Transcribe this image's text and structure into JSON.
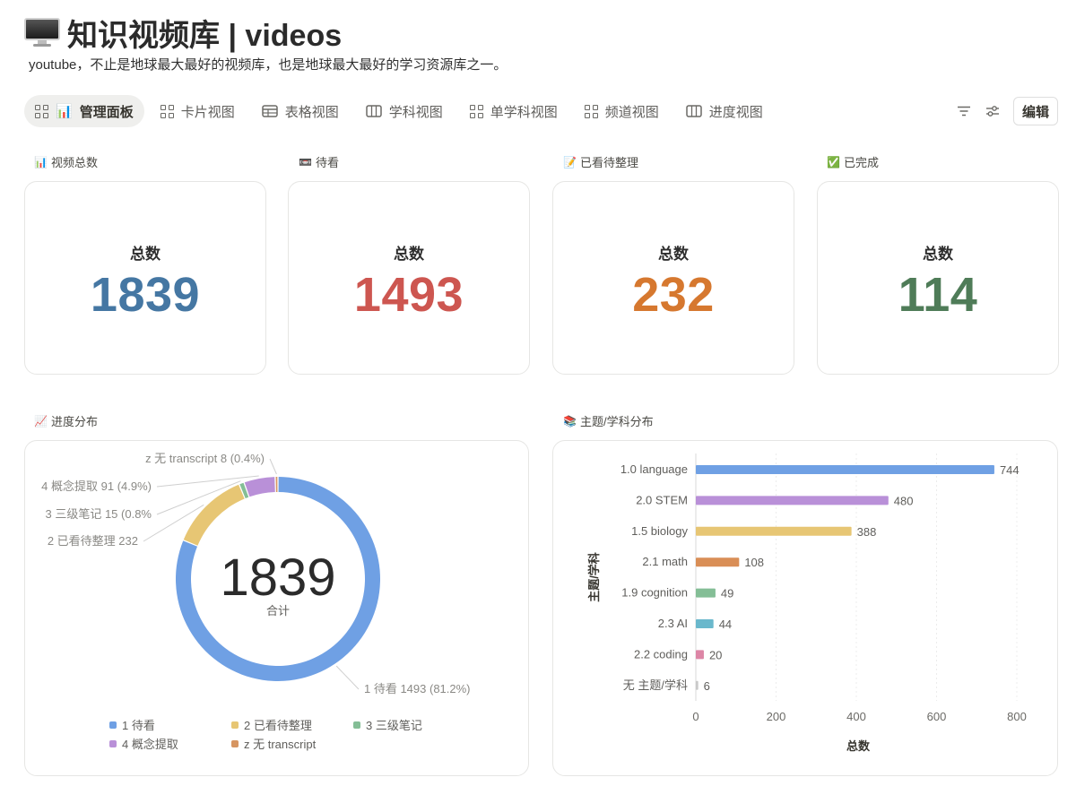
{
  "header": {
    "title": "知识视频库 | videos",
    "subtitle": "youtube，不止是地球最大最好的视频库，也是地球最大最好的学习资源库之一。"
  },
  "tabs": [
    {
      "label": "管理面板",
      "icon": "grid-icon",
      "emoji": "📊",
      "active": true
    },
    {
      "label": "卡片视图",
      "icon": "grid-icon"
    },
    {
      "label": "表格视图",
      "icon": "table-icon"
    },
    {
      "label": "学科视图",
      "icon": "columns-icon"
    },
    {
      "label": "单学科视图",
      "icon": "grid-icon"
    },
    {
      "label": "频道视图",
      "icon": "grid-icon"
    },
    {
      "label": "进度视图",
      "icon": "columns-icon"
    }
  ],
  "toolbar": {
    "edit_label": "编辑"
  },
  "stats": [
    {
      "section": "视频总数",
      "emoji": "📊",
      "label": "总数",
      "value": "1839",
      "color": "#4577a3"
    },
    {
      "section": "待看",
      "emoji": "📼",
      "label": "总数",
      "value": "1493",
      "color": "#cd5650"
    },
    {
      "section": "已看待整理",
      "emoji": "📝",
      "label": "总数",
      "value": "232",
      "color": "#d6782f"
    },
    {
      "section": "已完成",
      "emoji": "✅",
      "label": "总数",
      "value": "114",
      "color": "#4f7c58"
    }
  ],
  "progress_section": {
    "label": "进度分布",
    "emoji": "📈"
  },
  "subject_section": {
    "label": "主题/学科分布",
    "emoji": "📚"
  },
  "chart_data": [
    {
      "type": "pie",
      "center_value": "1839",
      "center_label": "合计",
      "slices": [
        {
          "name": "1 待看",
          "value": 1493,
          "label": "1 待看  1493 (81.2%)",
          "color": "#6fa0e4"
        },
        {
          "name": "2 已看待整理",
          "value": 232,
          "label": "2 已看待整理  232",
          "color": "#e7c674"
        },
        {
          "name": "3 三级笔记",
          "value": 15,
          "label": "3 三级笔记  15 (0.8%",
          "color": "#84be96"
        },
        {
          "name": "4 概念提取",
          "value": 91,
          "label": "4 概念提取  91 (4.9%)",
          "color": "#b990d8"
        },
        {
          "name": "z 无 transcript",
          "value": 8,
          "label": "z 无 transcript  8 (0.4%)",
          "color": "#d69561"
        }
      ],
      "legend_placement": "bottom"
    },
    {
      "type": "bar",
      "orientation": "horizontal",
      "categories": [
        "1.0 language",
        "2.0 STEM",
        "1.5 biology",
        "2.1 math",
        "1.9 cognition",
        "2.3 AI",
        "2.2 coding",
        "无 主题/学科"
      ],
      "values": [
        744,
        480,
        388,
        108,
        49,
        44,
        20,
        6
      ],
      "colors": [
        "#6fa0e4",
        "#b990d8",
        "#e7c674",
        "#d98e56",
        "#84be96",
        "#6ab8cc",
        "#dd86a6",
        "#c9c9c9"
      ],
      "xlabel": "总数",
      "ylabel": "主题/学科",
      "xlim": [
        0,
        800
      ],
      "xticks": [
        "0",
        "200",
        "400",
        "600",
        "800"
      ],
      "grid": true
    }
  ]
}
